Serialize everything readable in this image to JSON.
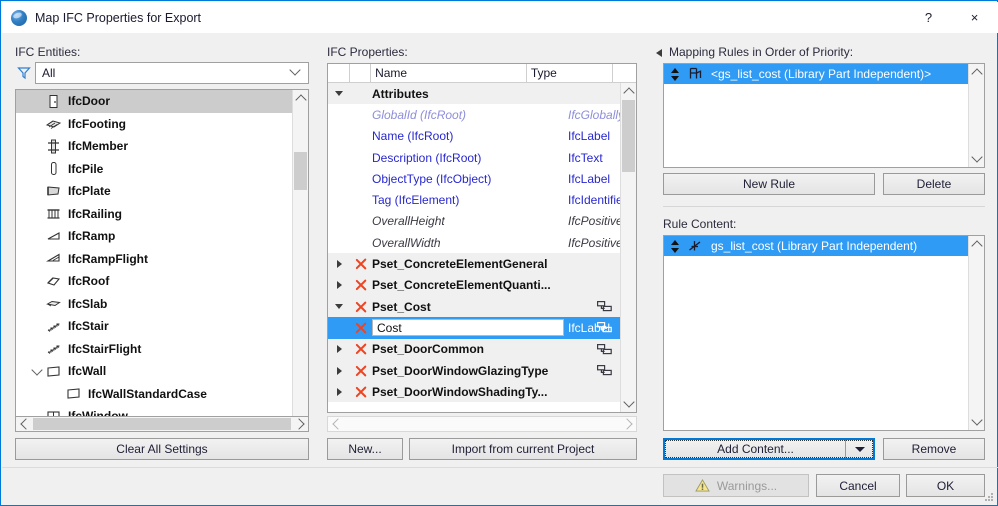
{
  "window": {
    "title": "Map IFC Properties for Export",
    "app_icon": "archicad-ball-icon",
    "help_label": "?",
    "close_label": "×"
  },
  "left": {
    "label": "IFC Entities:",
    "filter": {
      "icon": "filter-funnel-icon",
      "value": "All",
      "dropdown_icon": "chevron-down-icon"
    },
    "tree": [
      {
        "label": "IfcDoor",
        "icon": "door-icon",
        "indent": 1,
        "twisty": "none",
        "selected": true
      },
      {
        "label": "IfcFooting",
        "icon": "footing-icon",
        "indent": 1,
        "twisty": "none",
        "selected": false
      },
      {
        "label": "IfcMember",
        "icon": "member-icon",
        "indent": 1,
        "twisty": "none",
        "selected": false
      },
      {
        "label": "IfcPile",
        "icon": "pile-icon",
        "indent": 1,
        "twisty": "none",
        "selected": false
      },
      {
        "label": "IfcPlate",
        "icon": "plate-icon",
        "indent": 1,
        "twisty": "none",
        "selected": false
      },
      {
        "label": "IfcRailing",
        "icon": "railing-icon",
        "indent": 1,
        "twisty": "none",
        "selected": false
      },
      {
        "label": "IfcRamp",
        "icon": "ramp-icon",
        "indent": 1,
        "twisty": "none",
        "selected": false
      },
      {
        "label": "IfcRampFlight",
        "icon": "rampflight-icon",
        "indent": 1,
        "twisty": "none",
        "selected": false
      },
      {
        "label": "IfcRoof",
        "icon": "roof-icon",
        "indent": 1,
        "twisty": "none",
        "selected": false
      },
      {
        "label": "IfcSlab",
        "icon": "slab-icon",
        "indent": 1,
        "twisty": "none",
        "selected": false
      },
      {
        "label": "IfcStair",
        "icon": "stair-icon",
        "indent": 1,
        "twisty": "none",
        "selected": false
      },
      {
        "label": "IfcStairFlight",
        "icon": "stairflight-icon",
        "indent": 1,
        "twisty": "none",
        "selected": false
      },
      {
        "label": "IfcWall",
        "icon": "wall-icon",
        "indent": 1,
        "twisty": "expanded",
        "selected": false
      },
      {
        "label": "IfcWallStandardCase",
        "icon": "wall-icon",
        "indent": 2,
        "twisty": "none",
        "selected": false
      },
      {
        "label": "IfcWindow",
        "icon": "window-icon",
        "indent": 1,
        "twisty": "none",
        "selected": false
      }
    ],
    "clear_button": "Clear All Settings"
  },
  "middle": {
    "label": "IFC Properties:",
    "columns": [
      "",
      "",
      "Name",
      "Type",
      ""
    ],
    "rows": [
      {
        "name": "Attributes",
        "type": "",
        "style": "group",
        "twisty": "expanded",
        "xmark": false,
        "link": false
      },
      {
        "name": "GlobalId (IfcRoot)",
        "type": "IfcGloballyUni...",
        "style": "disabled",
        "twisty": "none",
        "xmark": false,
        "link": false
      },
      {
        "name": "Name (IfcRoot)",
        "type": "IfcLabel",
        "style": "attr",
        "twisty": "none",
        "xmark": false,
        "link": false
      },
      {
        "name": "Description (IfcRoot)",
        "type": "IfcText",
        "style": "attr",
        "twisty": "none",
        "xmark": false,
        "link": false
      },
      {
        "name": "ObjectType (IfcObject)",
        "type": "IfcLabel",
        "style": "attr",
        "twisty": "none",
        "xmark": false,
        "link": false
      },
      {
        "name": "Tag (IfcElement)",
        "type": "IfcIdentifier",
        "style": "attr",
        "twisty": "none",
        "xmark": false,
        "link": false
      },
      {
        "name": "OverallHeight",
        "type": "IfcPositiveLeng...",
        "style": "inactive",
        "twisty": "none",
        "xmark": false,
        "link": false
      },
      {
        "name": "OverallWidth",
        "type": "IfcPositiveLeng...",
        "style": "inactive",
        "twisty": "none",
        "xmark": false,
        "link": false
      },
      {
        "name": "Pset_ConcreteElementGeneral",
        "type": "",
        "style": "group",
        "twisty": "collapsed",
        "xmark": true,
        "link": false
      },
      {
        "name": "Pset_ConcreteElementQuanti...",
        "type": "",
        "style": "group",
        "twisty": "collapsed",
        "xmark": true,
        "link": false
      },
      {
        "name": "Pset_Cost",
        "type": "",
        "style": "group",
        "twisty": "expanded",
        "xmark": true,
        "link": true
      },
      {
        "name": "Cost",
        "type": "IfcLabel",
        "style": "selected",
        "twisty": "none",
        "xmark": true,
        "link": true,
        "editing": true
      },
      {
        "name": "Pset_DoorCommon",
        "type": "",
        "style": "group",
        "twisty": "collapsed",
        "xmark": true,
        "link": true
      },
      {
        "name": "Pset_DoorWindowGlazingType",
        "type": "",
        "style": "group",
        "twisty": "collapsed",
        "xmark": true,
        "link": true
      },
      {
        "name": "Pset_DoorWindowShadingTy...",
        "type": "",
        "style": "group",
        "twisty": "collapsed",
        "xmark": true,
        "link": false
      }
    ],
    "new_button": "New...",
    "import_button": "Import from current Project"
  },
  "right": {
    "rules_label": "Mapping Rules in Order of Priority:",
    "rules_collapse_icon": "triangle-left-icon",
    "rules": [
      {
        "label": "<gs_list_cost (Library Part Independent)>",
        "icon": "library-part-chair-icon",
        "selected": true
      }
    ],
    "new_rule_button": "New Rule",
    "delete_button": "Delete",
    "content_label": "Rule Content:",
    "content": [
      {
        "label": "gs_list_cost (Library Part Independent)",
        "icon": "parameter-icon",
        "selected": true
      }
    ],
    "add_content_button": "Add Content...",
    "add_content_dropdown_icon": "triangle-down-icon",
    "remove_button": "Remove"
  },
  "footer": {
    "warnings_button": "Warnings...",
    "warnings_icon": "warning-triangle-icon",
    "warnings_disabled": true,
    "cancel_button": "Cancel",
    "ok_button": "OK",
    "resize_grip": "resize-grip-icon"
  },
  "colors": {
    "accent": "#2f9bf5",
    "window_border": "#0078d7",
    "link_text": "#2727cf",
    "xmark": "#ee4422",
    "selection_gray": "#cccccc"
  }
}
